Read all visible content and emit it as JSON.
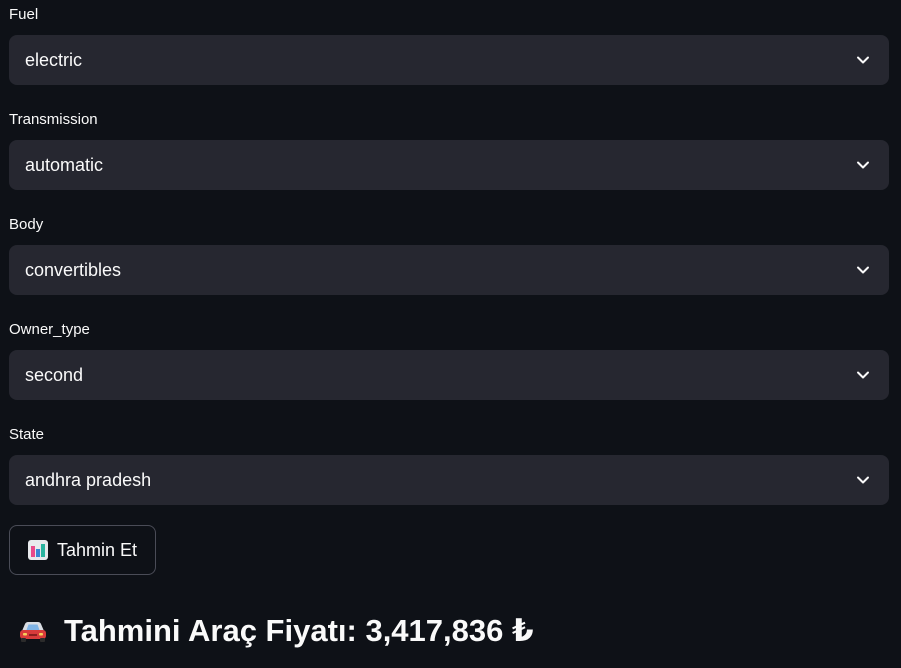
{
  "fields": [
    {
      "label": "Fuel",
      "value": "electric"
    },
    {
      "label": "Transmission",
      "value": "automatic"
    },
    {
      "label": "Body",
      "value": "convertibles"
    },
    {
      "label": "Owner_type",
      "value": "second"
    },
    {
      "label": "State",
      "value": "andhra pradesh"
    }
  ],
  "predict_button": {
    "label": "Tahmin Et",
    "icon": "bar-chart-icon"
  },
  "result": {
    "icon": "car-icon",
    "text": "Tahmini Araç Fiyatı: 3,417,836 ₺"
  },
  "colors": {
    "background": "#0e1117",
    "select_bg": "#262730",
    "text": "#fafafa",
    "button_border": "#4a4c57"
  }
}
